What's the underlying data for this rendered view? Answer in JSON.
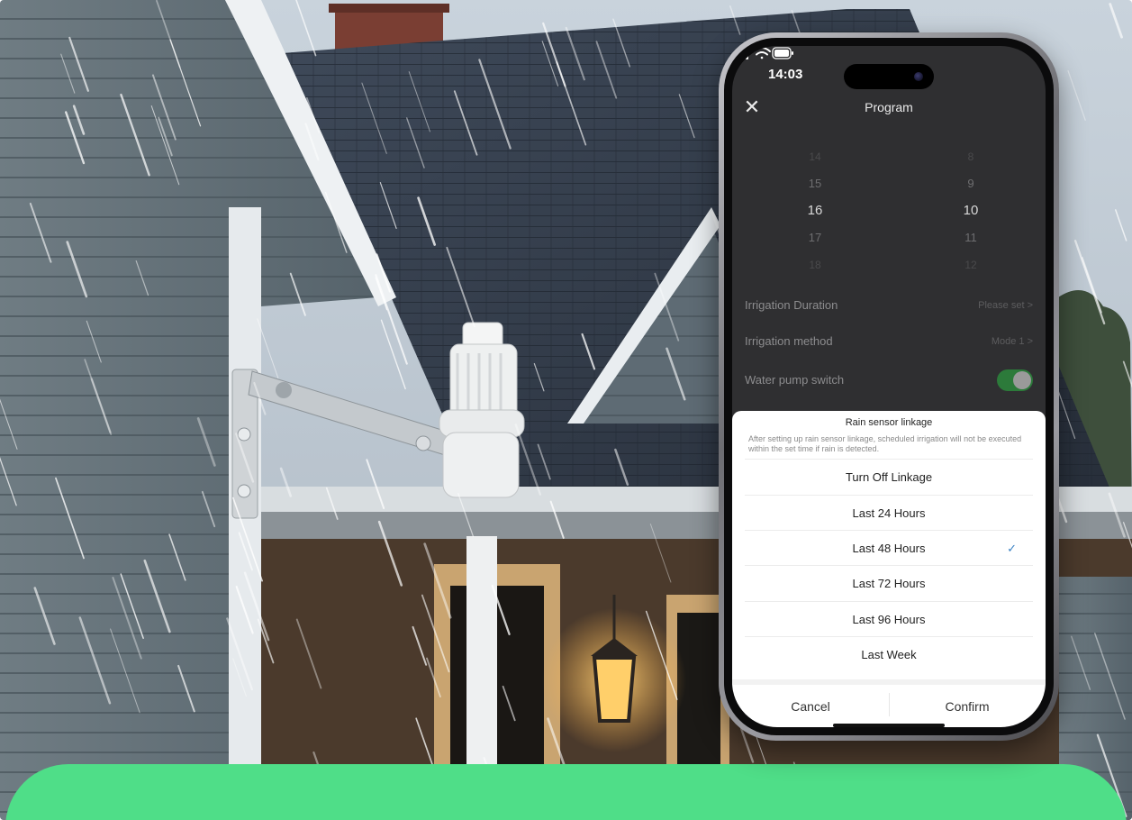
{
  "status_bar": {
    "time": "14:03"
  },
  "nav": {
    "close_icon": "close-icon",
    "title": "Program"
  },
  "picker": {
    "hours": [
      "14",
      "15",
      "16",
      "17",
      "18"
    ],
    "minutes": [
      "8",
      "9",
      "10",
      "11",
      "12"
    ]
  },
  "settings": {
    "duration_label": "Irrigation  Duration",
    "duration_value": "Please set >",
    "method_label": "Irrigation method",
    "method_value": "Mode 1 >",
    "pump_label": "Water pump switch",
    "pump_on": true
  },
  "sheet": {
    "title": "Rain sensor linkage",
    "description": "After setting up rain sensor linkage, scheduled irrigation will not be executed within the set time if rain is detected.",
    "options": [
      {
        "label": "Turn Off Linkage",
        "selected": false
      },
      {
        "label": "Last 24 Hours",
        "selected": false
      },
      {
        "label": "Last 48 Hours",
        "selected": true
      },
      {
        "label": "Last 72 Hours",
        "selected": false
      },
      {
        "label": "Last 96 Hours",
        "selected": false
      },
      {
        "label": "Last Week",
        "selected": false
      }
    ],
    "check_mark": "✓",
    "cancel_label": "Cancel",
    "confirm_label": "Confirm"
  },
  "colors": {
    "accent_green": "#4fde88",
    "toggle_green": "#2c7a3a",
    "check_blue": "#3b82c4"
  }
}
